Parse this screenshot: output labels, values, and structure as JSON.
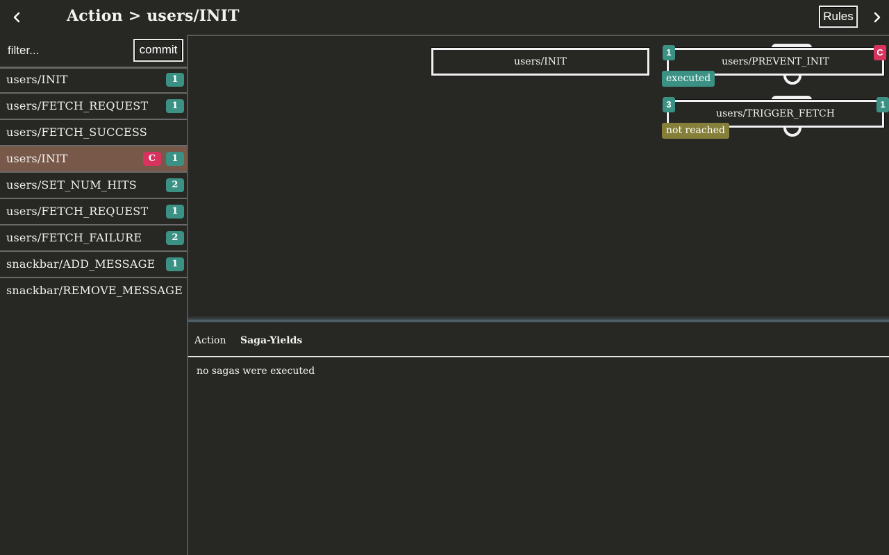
{
  "header": {
    "title": "Action > users/INIT",
    "back_icon": "chevron-left-icon",
    "forward_icon": "chevron-right-icon",
    "rules_label": "Rules"
  },
  "sidebar": {
    "filter_placeholder": "filter...",
    "filter_value": "",
    "commit_label": "commit",
    "items": [
      {
        "label": "users/INIT",
        "badges": [
          {
            "text": "1",
            "color": "teal"
          }
        ],
        "selected": false
      },
      {
        "label": "users/FETCH_REQUEST",
        "badges": [
          {
            "text": "1",
            "color": "teal"
          }
        ],
        "selected": false
      },
      {
        "label": "users/FETCH_SUCCESS",
        "badges": [],
        "selected": false
      },
      {
        "label": "users/INIT",
        "badges": [
          {
            "text": "C",
            "color": "pink"
          },
          {
            "text": "1",
            "color": "teal"
          }
        ],
        "selected": true
      },
      {
        "label": "users/SET_NUM_HITS",
        "badges": [
          {
            "text": "2",
            "color": "teal"
          }
        ],
        "selected": false
      },
      {
        "label": "users/FETCH_REQUEST",
        "badges": [
          {
            "text": "1",
            "color": "teal"
          }
        ],
        "selected": false
      },
      {
        "label": "users/FETCH_FAILURE",
        "badges": [
          {
            "text": "2",
            "color": "teal"
          }
        ],
        "selected": false
      },
      {
        "label": "snackbar/ADD_MESSAGE",
        "badges": [
          {
            "text": "1",
            "color": "teal"
          }
        ],
        "selected": false
      },
      {
        "label": "snackbar/REMOVE_MESSAGE",
        "badges": [],
        "selected": false
      }
    ]
  },
  "graph": {
    "root_node": {
      "label": "users/INIT"
    },
    "rules": [
      {
        "label": "users/PREVENT_INIT",
        "left_badge": "1",
        "left_badge_color": "teal",
        "right_badge": "C",
        "right_badge_color": "pink",
        "status": "executed"
      },
      {
        "label": "users/TRIGGER_FETCH",
        "left_badge": "3",
        "left_badge_color": "teal",
        "right_badge": "1",
        "right_badge_color": "teal",
        "status": "not reached"
      }
    ]
  },
  "bottom_panel": {
    "tabs": [
      {
        "label": "Action",
        "active": false
      },
      {
        "label": "Saga-Yields",
        "active": true
      }
    ],
    "message": "no sagas were executed"
  },
  "colors": {
    "background": "#272724",
    "teal": "#3a9184",
    "pink": "#d8325e",
    "olive": "#857f3a",
    "selected": "#785849"
  }
}
